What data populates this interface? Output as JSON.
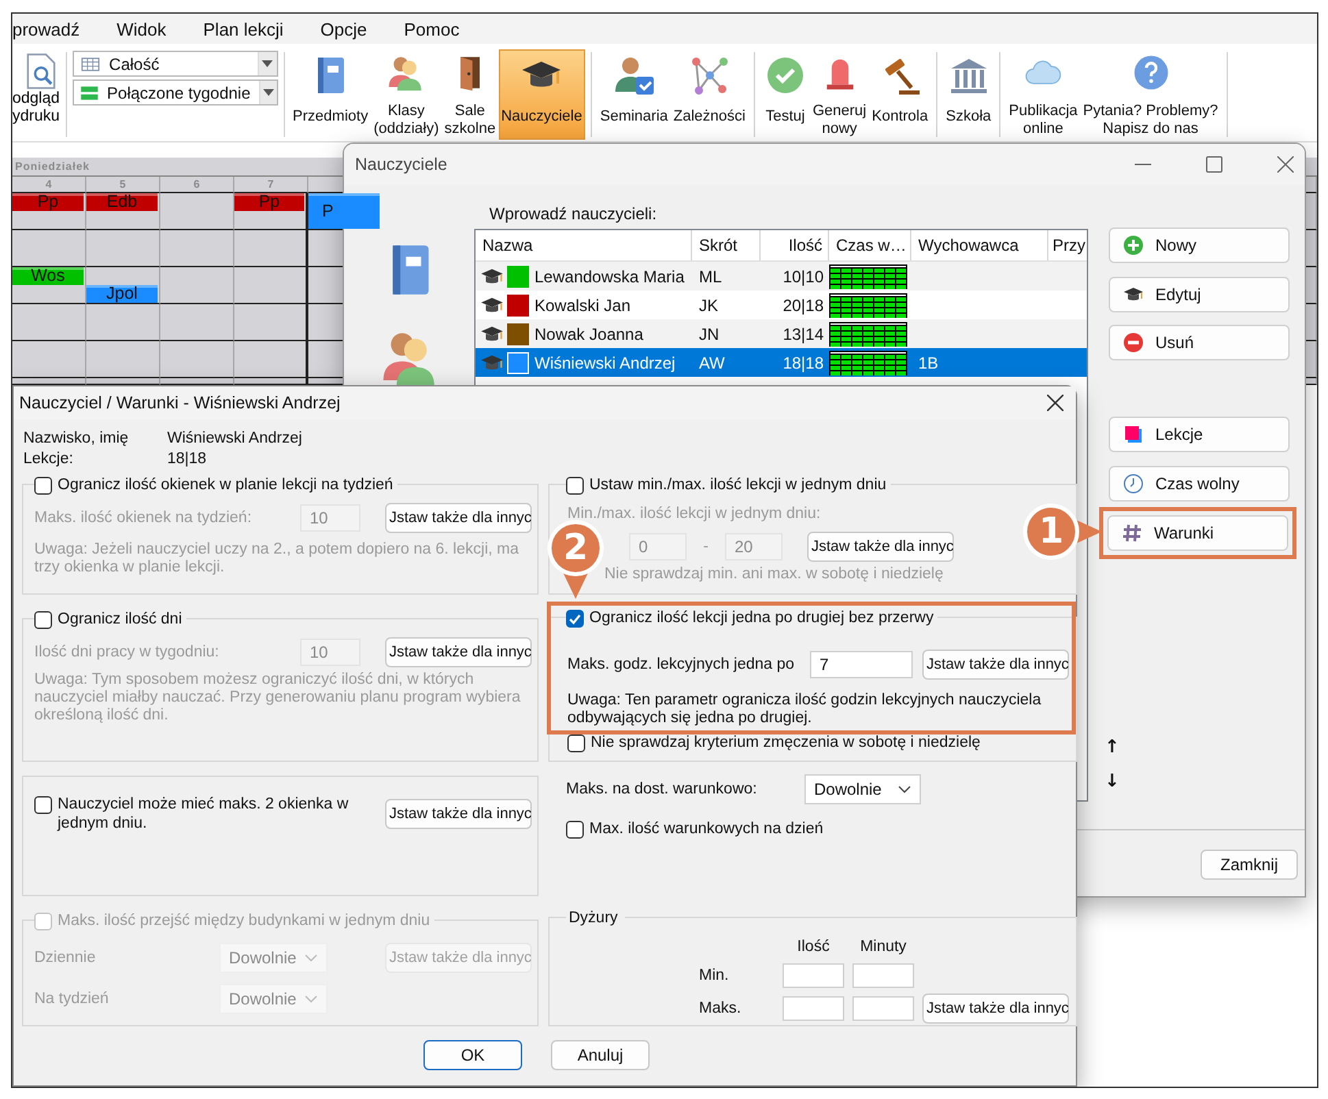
{
  "menu": [
    "prowadź",
    "Widok",
    "Plan lekcji",
    "Opcje",
    "Pomoc"
  ],
  "toolbar": {
    "preview": [
      "odgląd",
      "ydruku"
    ],
    "views": [
      {
        "label": "Całość"
      },
      {
        "label": "Połączone tygodnie"
      }
    ],
    "groups": [
      {
        "tools": [
          {
            "lines": [
              "Przedmioty"
            ],
            "selected": false
          },
          {
            "lines": [
              "Klasy",
              "(oddziały)"
            ],
            "selected": false
          },
          {
            "lines": [
              "Sale",
              "szkolne"
            ],
            "selected": false
          },
          {
            "lines": [
              "Nauczyciele"
            ],
            "selected": true
          }
        ]
      },
      {
        "tools": [
          {
            "lines": [
              "Seminaria"
            ],
            "selected": false
          },
          {
            "lines": [
              "Zależności"
            ],
            "selected": false
          }
        ]
      },
      {
        "tools": [
          {
            "lines": [
              "Testuj"
            ],
            "selected": false
          },
          {
            "lines": [
              "Generuj",
              "nowy"
            ],
            "selected": false
          },
          {
            "lines": [
              "Kontrola"
            ],
            "selected": false
          }
        ]
      },
      {
        "tools": [
          {
            "lines": [
              "Szkoła"
            ],
            "selected": false
          }
        ]
      },
      {
        "tools": [
          {
            "lines": [
              "Publikacja",
              "online"
            ],
            "selected": false
          },
          {
            "lines": [
              "Pytania? Problemy?",
              "Napisz do nas"
            ],
            "selected": false
          }
        ]
      }
    ]
  },
  "timetable": {
    "day": "Poniedziałek",
    "columns": [
      "4",
      "5",
      "6",
      "7"
    ],
    "lessons": [
      {
        "label": "Pp",
        "color": "#c00000"
      },
      {
        "label": "Edb",
        "color": "#c00000"
      },
      {
        "label": "Pp",
        "color": "#c00000"
      },
      {
        "label": "P",
        "color": "#1a8cff"
      },
      {
        "label": "Wos",
        "color": "#00c000"
      },
      {
        "label": "Jpol",
        "color": "#1a8cff"
      }
    ]
  },
  "teachers_window": {
    "title": "Nauczyciele",
    "prompt": "Wprowadź nauczycieli:",
    "columns": [
      "Nazwa",
      "Skrót",
      "Ilość",
      "Czas w…",
      "Wychowawca",
      "Przy"
    ],
    "rows": [
      {
        "name": "Lewandowska Maria",
        "color": "#00c000",
        "abbr": "ML",
        "count": "10|10",
        "selected": false
      },
      {
        "name": "Kowalski Jan",
        "color": "#c00000",
        "abbr": "JK",
        "count": "20|18",
        "selected": false
      },
      {
        "name": "Nowak Joanna",
        "color": "#7f4f00",
        "abbr": "JN",
        "count": "13|14",
        "selected": false
      },
      {
        "name": "Wiśniewski Andrzej",
        "color": "#1a8cff",
        "abbr": "AW",
        "count": "18|18",
        "form_class": "1B",
        "selected": true
      }
    ],
    "actions": [
      {
        "label": "Nowy",
        "highlighted": false
      },
      {
        "label": "Edytuj",
        "highlighted": false
      },
      {
        "label": "Usuń",
        "highlighted": false
      },
      {
        "label": "Lekcje",
        "highlighted": false
      },
      {
        "label": "Czas wolny",
        "highlighted": false
      },
      {
        "label": "Warunki",
        "highlighted": true
      }
    ],
    "order_buttons": [
      "↑",
      "↓"
    ],
    "close_button": "Zamknij"
  },
  "dialog": {
    "title": "Nauczyciel / Warunki - Wiśniewski Andrzej",
    "info": [
      {
        "label": "Nazwisko, imię",
        "value": "Wiśniewski Andrzej"
      },
      {
        "label": "Lekcje:",
        "value": "18|18"
      }
    ],
    "left": [
      {
        "kind": "group",
        "legend": {
          "kind": "checkbox",
          "label": "Ogranicz ilość okienek w planie lekcji na tydzień",
          "checked": false,
          "disabled": false
        },
        "items": [
          {
            "kind": "field",
            "label": "Maks. ilość okienek na tydzień:",
            "value": "10",
            "disabled": true,
            "button": {
              "label": "Jstaw także dla innyc",
              "disabled": false
            }
          },
          {
            "kind": "note",
            "text": "Uwaga: Jeżeli nauczyciel uczy na 2., a potem dopiero na 6. lekcji, ma trzy okienka w planie lekcji.",
            "disabled": true
          }
        ]
      },
      {
        "kind": "group",
        "legend": {
          "kind": "checkbox",
          "label": "Ogranicz ilość dni",
          "checked": false,
          "disabled": false
        },
        "items": [
          {
            "kind": "field",
            "label": "Ilość dni pracy w tygodniu:",
            "value": "10",
            "disabled": true,
            "button": {
              "label": "Jstaw także dla innyc",
              "disabled": false
            }
          },
          {
            "kind": "note",
            "text": "Uwaga: Tym sposobem możesz ograniczyć ilość dni, w których nauczyciel miałby nauczać. Przy generowaniu planu program wybiera określoną ilość dni.",
            "disabled": true
          }
        ]
      },
      {
        "kind": "group",
        "items": [
          {
            "kind": "checkbox",
            "label": "Nauczyciel może mieć maks. 2 okienka w jednym dniu.",
            "checked": false,
            "disabled": false,
            "button": {
              "label": "Jstaw także dla innyc",
              "disabled": false
            }
          }
        ]
      },
      {
        "kind": "group",
        "legend": {
          "kind": "checkbox",
          "label": "Maks. ilość przejść między budynkami w jednym dniu",
          "checked": false,
          "disabled": true
        },
        "items": [
          {
            "kind": "select",
            "label": "Dziennie",
            "value": "Dowolnie",
            "disabled": true,
            "button": {
              "label": "Jstaw także dla innyc",
              "disabled": true
            }
          },
          {
            "kind": "select",
            "label": "Na tydzień",
            "value": "Dowolnie",
            "disabled": true
          }
        ]
      }
    ],
    "right": [
      {
        "kind": "group",
        "legend": {
          "kind": "checkbox",
          "label": "Ustaw min./max. ilość lekcji w jednym dniu",
          "checked": false,
          "disabled": false
        },
        "items": [
          {
            "kind": "caption",
            "text": "Min./max. ilość lekcji w jednym dniu:",
            "disabled": true
          },
          {
            "kind": "range",
            "from": "0",
            "separator": "-",
            "to": "20",
            "disabled": true,
            "button": {
              "label": "Jstaw także dla innyc",
              "disabled": false
            }
          },
          {
            "kind": "caption",
            "text": "Nie sprawdzaj min. ani max. w sobotę i niedzielę",
            "disabled": true
          }
        ]
      },
      {
        "kind": "group",
        "highlighted": true,
        "legend": {
          "kind": "checkbox",
          "label": "Ogranicz ilość lekcji jedna po drugiej bez przerwy",
          "checked": true,
          "disabled": false
        },
        "items": [
          {
            "kind": "field",
            "label": "Maks. godz. lekcyjnych jedna po",
            "value": "7",
            "disabled": false,
            "button": {
              "label": "Jstaw także dla innyc",
              "disabled": false
            }
          },
          {
            "kind": "note",
            "text": "Uwaga: Ten parametr ogranicza ilość godzin lekcyjnych nauczyciela odbywających się jedna po drugiej.",
            "disabled": false
          },
          {
            "kind": "checkbox",
            "label": "Nie sprawdzaj kryterium zmęczenia w sobotę i niedzielę",
            "checked": false,
            "disabled": false
          }
        ]
      },
      {
        "kind": "plain",
        "items": [
          {
            "kind": "select",
            "label": "Maks. na dost. warunkowo:",
            "value": "Dowolnie",
            "disabled": false
          },
          {
            "kind": "checkbox",
            "label": "Max. ilość warunkowych na dzień",
            "checked": false,
            "disabled": false
          }
        ]
      },
      {
        "kind": "group",
        "legend": {
          "kind": "title",
          "text": "Dyżury"
        },
        "items": [
          {
            "kind": "duty",
            "columns": [
              "Ilość",
              "Minuty"
            ],
            "rows": [
              {
                "label": "Min."
              },
              {
                "label": "Maks.",
                "button": {
                  "label": "Jstaw także dla innyc",
                  "disabled": false
                }
              }
            ]
          }
        ]
      }
    ],
    "buttons": [
      {
        "label": "OK",
        "default": true
      },
      {
        "label": "Anuluj",
        "default": false
      }
    ]
  },
  "callouts": [
    {
      "label": "1"
    },
    {
      "label": "2"
    }
  ]
}
